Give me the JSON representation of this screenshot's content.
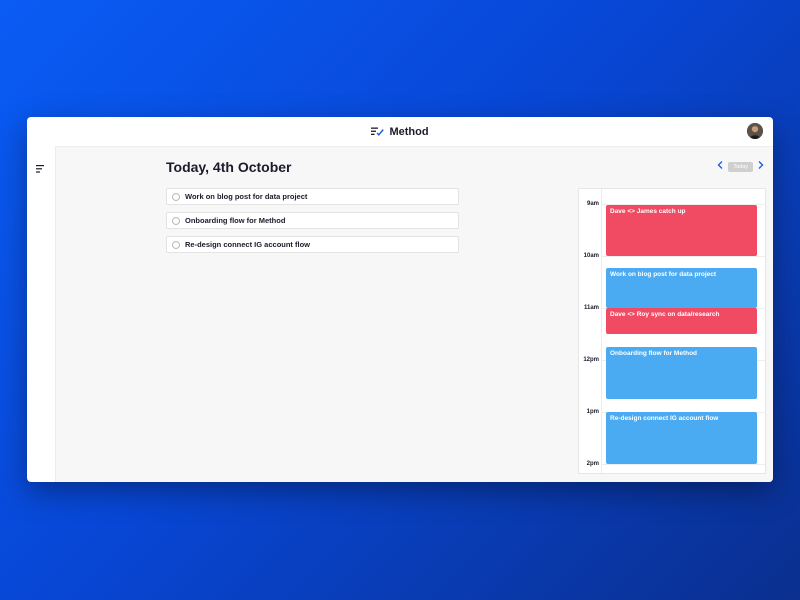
{
  "app": {
    "title": "Method",
    "logo_icon": "checklist-icon",
    "avatar_icon": "user-avatar-icon",
    "menu_icon": "menu-lines-icon"
  },
  "main": {
    "title": "Today, 4th October",
    "tasks": [
      {
        "label": "Work on blog post for data project"
      },
      {
        "label": "Onboarding flow for Method"
      },
      {
        "label": "Re-design connect IG account flow"
      }
    ]
  },
  "calendar_nav": {
    "prev_icon": "chevron-left-icon",
    "today_label": "Today",
    "next_icon": "chevron-right-icon"
  },
  "calendar": {
    "hours": [
      "9am",
      "10am",
      "11am",
      "12pm",
      "1pm",
      "2pm"
    ],
    "events": [
      {
        "title": "Dave <> James catch up",
        "color": "#f04b63"
      },
      {
        "title": "Work on blog post for data project",
        "color": "#4aabf2"
      },
      {
        "title": "Dave <> Roy sync on data/research",
        "color": "#f04b63"
      },
      {
        "title": "Onboarding flow for Method",
        "color": "#4aabf2"
      },
      {
        "title": "Re-design connect IG account flow",
        "color": "#4aabf2"
      }
    ]
  },
  "colors": {
    "accent": "#1f5fe0",
    "event_red": "#f04b63",
    "event_blue": "#4aabf2",
    "background_gradient_start": "#0a5cf5",
    "background_gradient_end": "#0a2f8f"
  }
}
